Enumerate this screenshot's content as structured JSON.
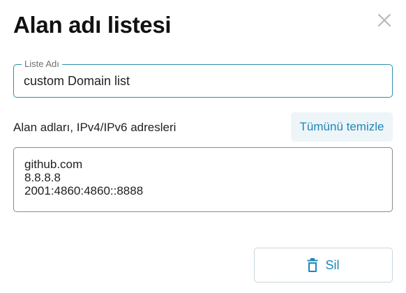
{
  "dialog": {
    "title": "Alan adı listesi",
    "close_icon": "close-icon"
  },
  "name_field": {
    "label": "Liste Adı",
    "value": "custom Domain list"
  },
  "domains": {
    "label": "Alan adları, IPv4/IPv6 adresleri",
    "clear_all_label": "Tümünü temizle",
    "value": "github.com\n8.8.8.8\n2001:4860:4860::8888"
  },
  "footer": {
    "delete_label": "Sil",
    "delete_icon": "trash-icon"
  },
  "colors": {
    "accent": "#1c88b8",
    "field_border_focused": "#2d8fb3",
    "clear_button_bg": "#eef5f9"
  }
}
